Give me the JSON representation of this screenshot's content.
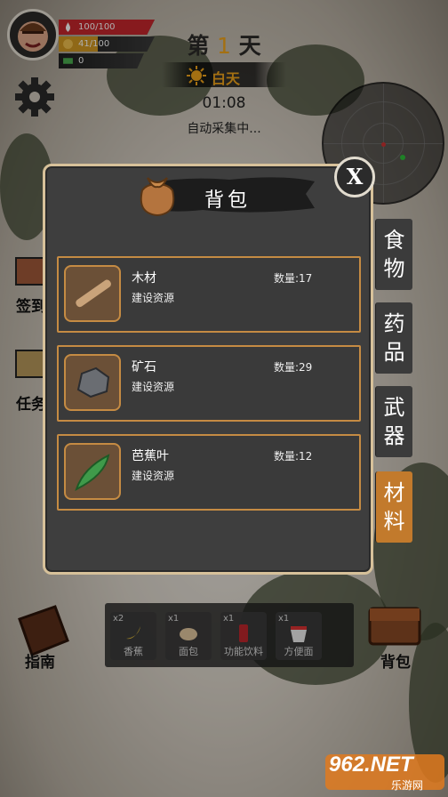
{
  "hud": {
    "hp": "100/100",
    "hp_fraction": 1.0,
    "hunger": "41/100",
    "hunger_fraction": 0.41,
    "money": "0",
    "day_prefix": "第",
    "day_number": "1",
    "day_suffix": "天",
    "time_of_day": "白天",
    "clock": "01:08",
    "auto_status": "自动采集中..."
  },
  "side": {
    "signin_label": "签到",
    "task_label": "任务"
  },
  "bottom": {
    "guide_label": "指南",
    "bag_label": "背包",
    "quick_slots": [
      {
        "count": "x2",
        "name": "香蕉"
      },
      {
        "count": "x1",
        "name": "面包"
      },
      {
        "count": "x1",
        "name": "功能饮料"
      },
      {
        "count": "x1",
        "name": "方便面"
      }
    ]
  },
  "modal": {
    "title": "背包",
    "close_label": "X",
    "items": [
      {
        "name": "木材",
        "desc": "建设资源",
        "qty": "数量:17"
      },
      {
        "name": "矿石",
        "desc": "建设资源",
        "qty": "数量:29"
      },
      {
        "name": "芭蕉叶",
        "desc": "建设资源",
        "qty": "数量:12"
      }
    ],
    "tabs": [
      {
        "l1": "食",
        "l2": "物",
        "active": false
      },
      {
        "l1": "药",
        "l2": "品",
        "active": false
      },
      {
        "l1": "武",
        "l2": "器",
        "active": false
      },
      {
        "l1": "材",
        "l2": "料",
        "active": true
      }
    ]
  },
  "watermark": {
    "num": "962",
    "net": ".NET",
    "sub": "乐游网"
  },
  "colors": {
    "accent": "#c27a2c",
    "border": "#c58b43",
    "hp": "#c8272d",
    "hunger": "#d39a22",
    "day_number": "#f2a51b"
  }
}
